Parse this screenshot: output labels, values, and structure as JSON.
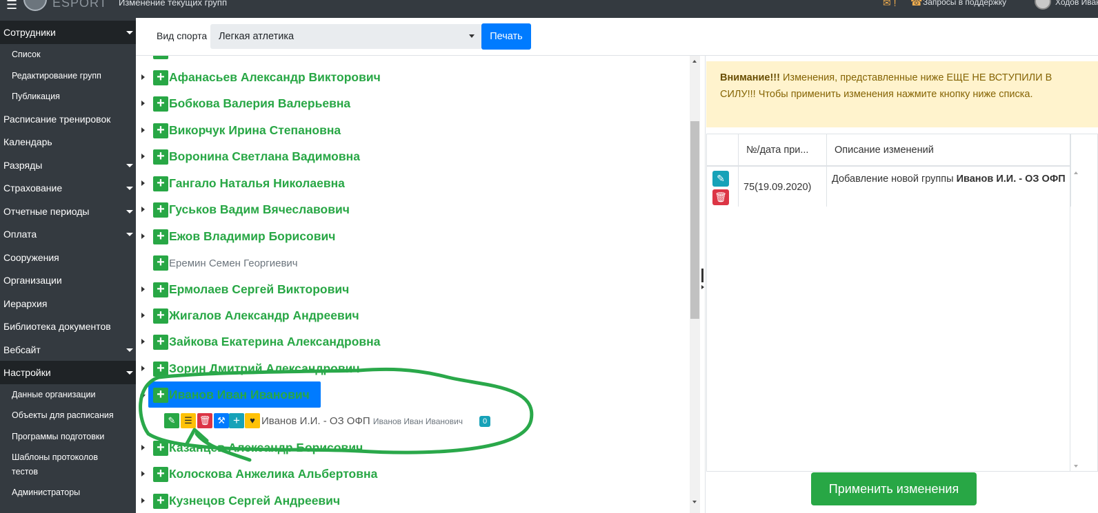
{
  "topbar": {
    "logo_text": "ESPORT",
    "page_title": "Изменение текущих групп",
    "mail_count": "!",
    "support_label": "Запросы в поддержку",
    "user_name": "Ходов Иван"
  },
  "sidebar": {
    "items": [
      {
        "label": "Сотрудники"
      },
      {
        "label": "Список"
      },
      {
        "label": "Редактирование групп"
      },
      {
        "label": "Публикация"
      },
      {
        "label": "Расписание тренировок"
      },
      {
        "label": "Календарь"
      },
      {
        "label": "Разряды"
      },
      {
        "label": "Страхование"
      },
      {
        "label": "Отчетные периоды"
      },
      {
        "label": "Оплата"
      },
      {
        "label": "Сооружения"
      },
      {
        "label": "Организации"
      },
      {
        "label": "Иерархия"
      },
      {
        "label": "Библиотека документов"
      },
      {
        "label": "Вебсайт"
      },
      {
        "label": "Настройки"
      },
      {
        "label": "Данные организации"
      },
      {
        "label": "Объекты для расписания"
      },
      {
        "label": "Программы подготовки"
      },
      {
        "label": "Шаблоны протоколов тестов"
      },
      {
        "label": "Администраторы"
      }
    ]
  },
  "filter": {
    "label": "Вид спорта",
    "selected": "Легкая атлетика",
    "print_label": "Печать"
  },
  "tree": {
    "rows": [
      {
        "name": "Афанасьев Александр Викторович"
      },
      {
        "name": "Бобкова Валерия Валерьевна"
      },
      {
        "name": "Викорчук Ирина Степановна"
      },
      {
        "name": "Воронина Светлана Вадимовна"
      },
      {
        "name": "Гангало Наталья Николаевна"
      },
      {
        "name": "Гуськов Вадим Вячеславович"
      },
      {
        "name": "Ежов Владимир Борисович"
      },
      {
        "name": "Еремин Семен Георгиевич"
      },
      {
        "name": "Ермолаев Сергей Викторович"
      },
      {
        "name": "Жигалов Александр Андреевич"
      },
      {
        "name": "Зайкова Екатерина Александровна"
      },
      {
        "name": "Зорин Дмитрий Александрович"
      },
      {
        "name": "Иванов Иван Иванович"
      },
      {
        "name": "Казанцев Александр Борисович"
      },
      {
        "name": "Колоскова Анжелика Альбертовна"
      },
      {
        "name": "Кузнецов Сергей Андреевич"
      }
    ],
    "group": {
      "title": "Иванов И.И. - ОЗ ОФП",
      "trainer": "Иванов Иван Иванович",
      "badge": "0"
    }
  },
  "alert": {
    "strong": "Внимание!!!",
    "text": "Изменения, представленные ниже ЕЩЕ НЕ ВСТУПИЛИ В СИЛУ!!! Чтобы применить изменения нажмите кнопку ниже списка."
  },
  "changes_table": {
    "headers": [
      "№/дата при...",
      "Описание изменений"
    ],
    "rows": [
      {
        "num_date": "75(19.09.2020)",
        "desc_prefix": "Добавление новой группы",
        "desc_bold": "Иванов И.И. - ОЗ ОФП"
      }
    ]
  },
  "apply_label": "Применить изменения",
  "colors": {
    "green": "#28a745",
    "blue": "#007bff",
    "dark": "#343a40",
    "warning_bg": "#fff3cd",
    "annotation": "#2aa84a"
  }
}
